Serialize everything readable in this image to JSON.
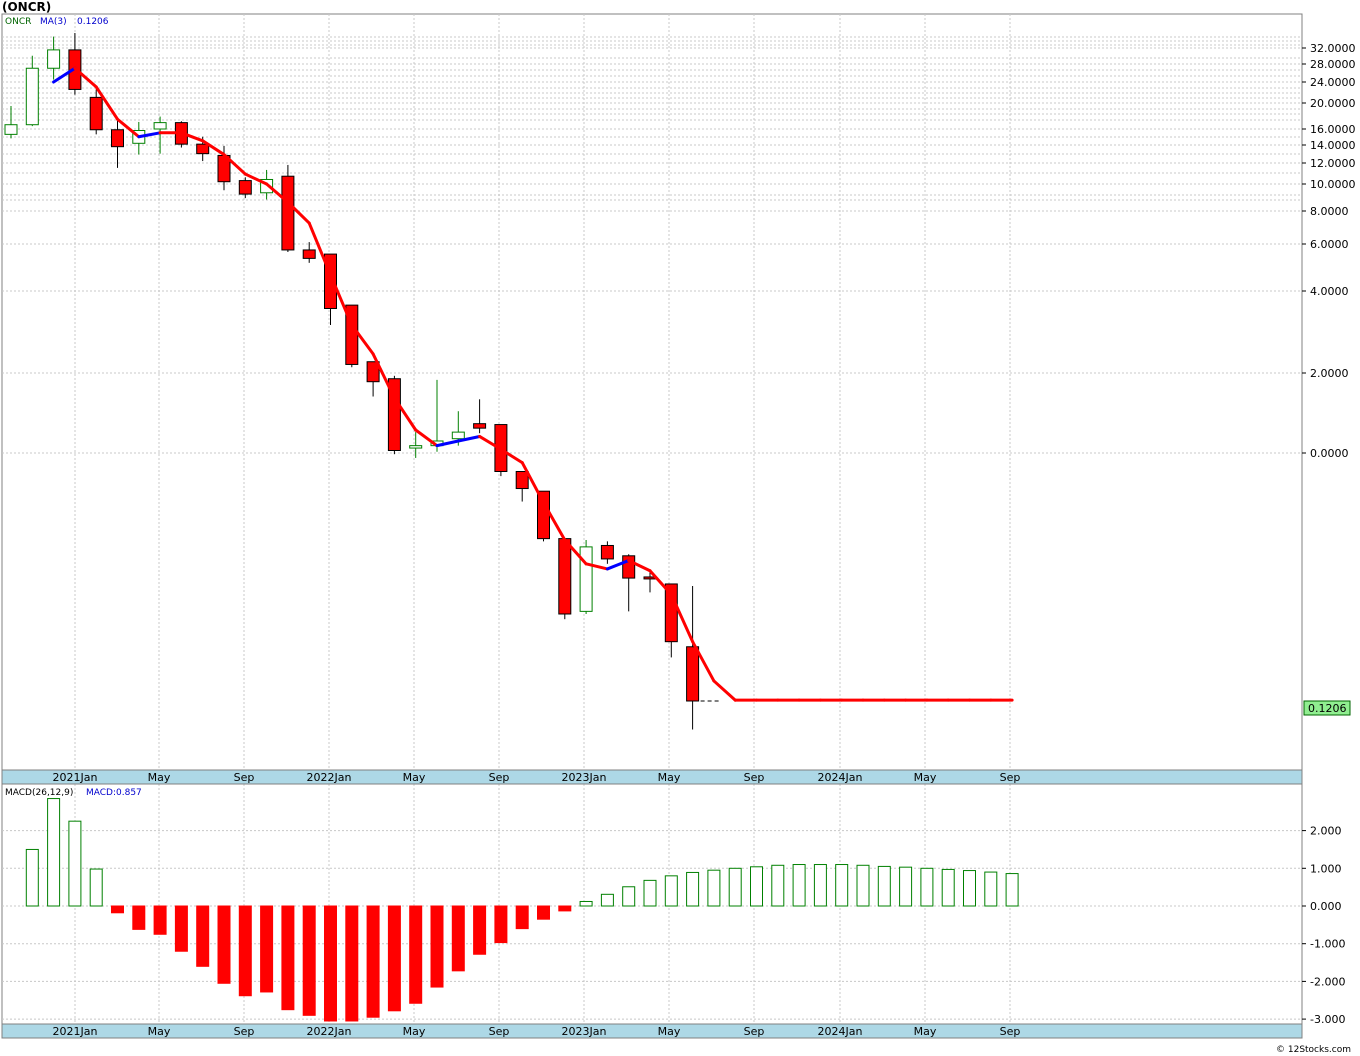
{
  "title": "(ONCR)",
  "watermark": "© 12Stocks.com",
  "price_panel": {
    "symbol_label": "ONCR",
    "ma_label": "MA(3)",
    "ma_value": "0.1206",
    "last_price_label": "0.1206"
  },
  "macd_panel": {
    "label": "MACD(26,12,9)",
    "value_label": "MACD:0.857"
  },
  "x_labels": [
    "2021Jan",
    "May",
    "Sep",
    "2022Jan",
    "May",
    "Sep",
    "2023Jan",
    "May",
    "Sep",
    "2024Jan",
    "May",
    "Sep"
  ],
  "colors": {
    "up": "#008000",
    "down": "#ff0000",
    "ma_down": "#ff0000",
    "ma_up": "#0000ff",
    "axis_bg": "#add8e6",
    "last_price_bg": "#90ee90"
  },
  "chart_data": [
    {
      "type": "candlestick",
      "name": "ONCR monthly price",
      "y_scale": "log",
      "y_ticks": [
        "32.0000",
        "28.0000",
        "24.0000",
        "20.0000",
        "16.0000",
        "14.0000",
        "12.0000",
        "10.0000",
        "8.0000",
        "6.0000",
        "4.0000",
        "2.0000",
        "0.0000",
        "0.1206"
      ],
      "candles": [
        {
          "o": 15.3,
          "h": 19.5,
          "l": 14.8,
          "c": 16.6
        },
        {
          "o": 16.6,
          "h": 30.0,
          "l": 16.4,
          "c": 27.0
        },
        {
          "o": 27.0,
          "h": 35.0,
          "l": 24.5,
          "c": 31.5
        },
        {
          "o": 31.5,
          "h": 36.0,
          "l": 21.5,
          "c": 22.5
        },
        {
          "o": 21.0,
          "h": 22.5,
          "l": 15.3,
          "c": 15.9
        },
        {
          "o": 15.9,
          "h": 17.2,
          "l": 11.5,
          "c": 13.8
        },
        {
          "o": 14.2,
          "h": 17.0,
          "l": 12.9,
          "c": 15.8
        },
        {
          "o": 16.0,
          "h": 17.8,
          "l": 13.0,
          "c": 16.9
        },
        {
          "o": 16.9,
          "h": 17.1,
          "l": 13.7,
          "c": 14.1
        },
        {
          "o": 14.1,
          "h": 15.0,
          "l": 12.2,
          "c": 13.0
        },
        {
          "o": 12.8,
          "h": 13.9,
          "l": 9.5,
          "c": 10.2
        },
        {
          "o": 10.3,
          "h": 10.6,
          "l": 8.9,
          "c": 9.2
        },
        {
          "o": 9.3,
          "h": 11.3,
          "l": 8.8,
          "c": 10.4
        },
        {
          "o": 10.7,
          "h": 11.8,
          "l": 5.6,
          "c": 5.7
        },
        {
          "o": 5.7,
          "h": 6.1,
          "l": 5.1,
          "c": 5.3
        },
        {
          "o": 5.5,
          "h": 5.5,
          "l": 3.0,
          "c": 3.45
        },
        {
          "o": 3.55,
          "h": 3.55,
          "l": 2.1,
          "c": 2.15
        },
        {
          "o": 2.2,
          "h": 2.2,
          "l": 1.62,
          "c": 1.85
        },
        {
          "o": 1.9,
          "h": 1.95,
          "l": 0.98,
          "c": 1.02
        },
        {
          "o": 1.04,
          "h": 1.18,
          "l": 0.92,
          "c": 1.06
        },
        {
          "o": 1.06,
          "h": 1.88,
          "l": 1.01,
          "c": 1.1
        },
        {
          "o": 1.12,
          "h": 1.42,
          "l": 1.06,
          "c": 1.18
        },
        {
          "o": 1.27,
          "h": 1.58,
          "l": 1.17,
          "c": 1.22
        },
        {
          "o": 1.26,
          "h": 1.26,
          "l": 0.71,
          "c": 0.74
        },
        {
          "o": 0.74,
          "h": 0.74,
          "l": 0.565,
          "c": 0.635
        },
        {
          "o": 0.62,
          "h": 0.62,
          "l": 0.395,
          "c": 0.405
        },
        {
          "o": 0.405,
          "h": 0.405,
          "l": 0.194,
          "c": 0.2
        },
        {
          "o": 0.205,
          "h": 0.4,
          "l": 0.2,
          "c": 0.375
        },
        {
          "o": 0.38,
          "h": 0.395,
          "l": 0.32,
          "c": 0.335
        },
        {
          "o": 0.345,
          "h": 0.35,
          "l": 0.205,
          "c": 0.28
        },
        {
          "o": 0.283,
          "h": 0.3,
          "l": 0.245,
          "c": 0.278
        },
        {
          "o": 0.265,
          "h": 0.265,
          "l": 0.155,
          "c": 0.17
        },
        {
          "o": 0.165,
          "h": 0.26,
          "l": 0.075,
          "c": 0.12
        }
      ],
      "ma3": [
        null,
        null,
        24.0,
        27.0,
        23.0,
        17.4,
        15.0,
        15.5,
        15.5,
        14.5,
        12.9,
        10.9,
        10.0,
        8.6,
        7.2,
        4.6,
        3.0,
        2.35,
        1.6,
        1.2,
        1.06,
        1.1,
        1.14,
        1.03,
        0.85,
        0.56,
        0.4,
        0.32,
        0.305,
        0.33,
        0.3,
        0.24,
        0.17,
        0.135,
        0.1206,
        0.1206,
        0.1206,
        0.1206,
        0.1206,
        0.1206,
        0.1206,
        0.1206,
        0.1206,
        0.1206,
        0.1206,
        0.1206,
        0.1206,
        0.1206
      ]
    },
    {
      "type": "bar",
      "name": "MACD(26,12,9)",
      "y_ticks": [
        "2.000",
        "1.000",
        "0.000",
        "-1.000",
        "-2.000",
        "-3.000"
      ],
      "ylim": [
        -3.2,
        2.9
      ],
      "values": [
        1.5,
        2.85,
        2.25,
        0.98,
        -0.18,
        -0.62,
        -0.75,
        -1.2,
        -1.6,
        -2.05,
        -2.38,
        -2.28,
        -2.75,
        -2.9,
        -3.05,
        -3.05,
        -2.95,
        -2.78,
        -2.58,
        -2.15,
        -1.72,
        -1.28,
        -0.97,
        -0.6,
        -0.35,
        -0.13,
        0.12,
        0.31,
        0.51,
        0.68,
        0.8,
        0.89,
        0.95,
        1.0,
        1.04,
        1.08,
        1.1,
        1.1,
        1.1,
        1.08,
        1.05,
        1.03,
        1.0,
        0.97,
        0.94,
        0.9,
        0.86
      ]
    }
  ]
}
